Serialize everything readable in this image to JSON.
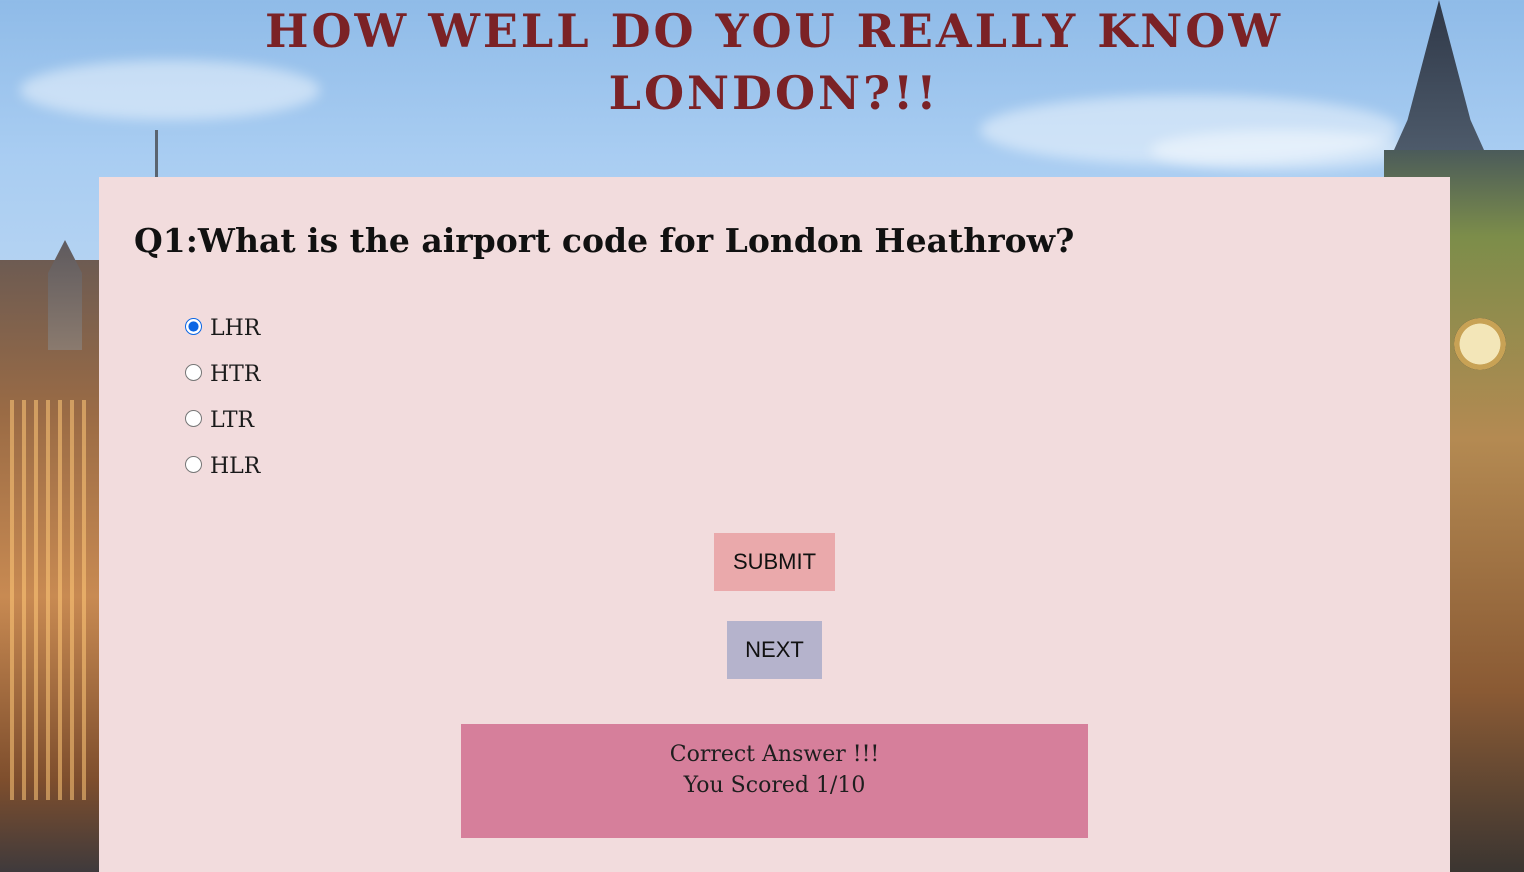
{
  "header": {
    "title_line1": "HOW WELL DO YOU REALLY KNOW",
    "title_line2": "LONDON?!!"
  },
  "quiz": {
    "question": "Q1:What is the airport code for London Heathrow?",
    "options": [
      {
        "label": "LHR",
        "selected": true
      },
      {
        "label": "HTR",
        "selected": false
      },
      {
        "label": "LTR",
        "selected": false
      },
      {
        "label": "HLR",
        "selected": false
      }
    ],
    "submit_label": "SUBMIT",
    "next_label": "NEXT"
  },
  "result": {
    "message": "Correct Answer !!!",
    "score": "You Scored 1/10"
  },
  "colors": {
    "title": "#7b2226",
    "card": "#f2dcdd",
    "submit_button": "#eaa9ab",
    "next_button": "#b5b3cc",
    "result_box": "#d67f9b",
    "radio_accent": "#0b66e4"
  }
}
